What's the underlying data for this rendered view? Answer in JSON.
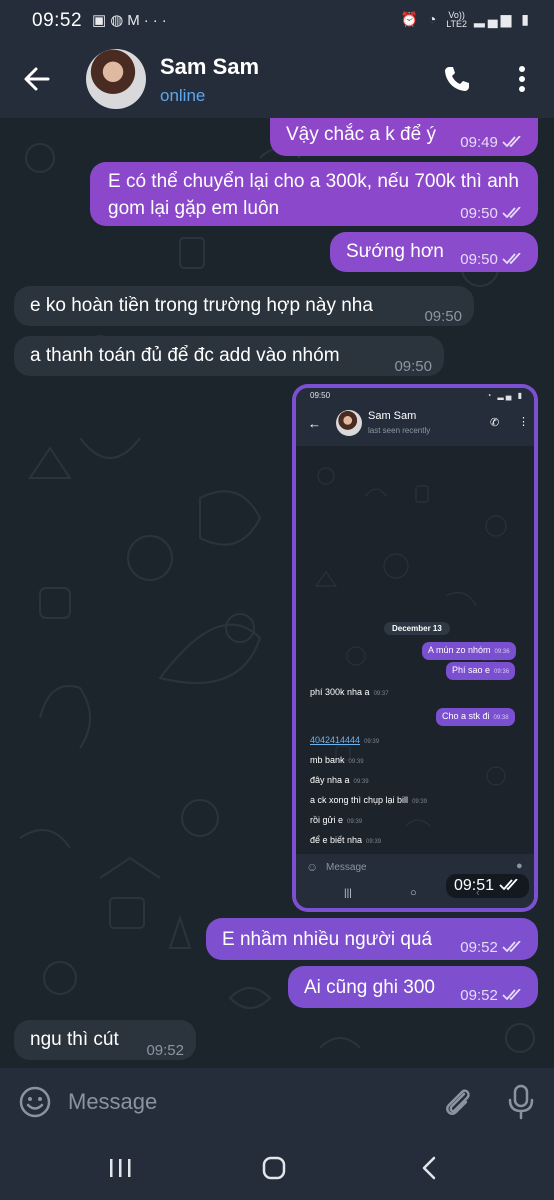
{
  "status_bar": {
    "time": "09:52",
    "left_icons": [
      "gallery-icon",
      "globe-icon",
      "gmail-icon",
      "more-dots-icon"
    ],
    "network_label_top": "Vo))",
    "network_label_bottom": "LTE2"
  },
  "header": {
    "name": "Sam Sam",
    "status": "online"
  },
  "messages": [
    {
      "text": "Vậy chắc a k để ý",
      "time": "09:49",
      "direction": "out"
    },
    {
      "text": "E có thể chuyển lại cho a 300k, nếu 700k thì anh gom lại gặp em luôn",
      "time": "09:50",
      "direction": "out"
    },
    {
      "text": "Sướng hơn",
      "time": "09:50",
      "direction": "out"
    },
    {
      "text": "e ko hoàn tiền trong trường hợp này nha",
      "time": "09:50",
      "direction": "in"
    },
    {
      "text": "a thanh toán đủ để đc add vào nhóm",
      "time": "09:50",
      "direction": "in"
    },
    {
      "text": "E nhầm nhiều người quá",
      "time": "09:52",
      "direction": "out"
    },
    {
      "text": "Ai cũng ghi 300",
      "time": "09:52",
      "direction": "out"
    },
    {
      "text": "ngu thì cút",
      "time": "09:52",
      "direction": "in"
    }
  ],
  "screenshot_message": {
    "time": "09:51",
    "inner": {
      "status_time": "09:50",
      "name": "Sam Sam",
      "last_seen": "last seen recently",
      "date_chip": "December 13",
      "messages": [
        {
          "text": "A mún zo nhóm",
          "time": "09:36",
          "direction": "out"
        },
        {
          "text": "Phí sao e",
          "time": "09:36",
          "direction": "out"
        },
        {
          "text": "phí 300k nha a",
          "time": "09:37",
          "direction": "in"
        },
        {
          "text": "Cho a stk đi",
          "time": "09:38",
          "direction": "out"
        },
        {
          "text": "4042414444",
          "time": "09:39",
          "direction": "in"
        },
        {
          "text": "mb bank",
          "time": "09:39",
          "direction": "in"
        },
        {
          "text": "đây nha a",
          "time": "09:39",
          "direction": "in"
        },
        {
          "text": "a ck xong thì chụp lại bill",
          "time": "09:39",
          "direction": "in"
        },
        {
          "text": "rồi gửi e",
          "time": "09:39",
          "direction": "in"
        },
        {
          "text": "để e biết nha",
          "time": "09:39",
          "direction": "in"
        }
      ],
      "input_placeholder": "Message"
    }
  },
  "input": {
    "placeholder": "Message"
  },
  "colors": {
    "outgoing_bubble": "#7e4fcf",
    "incoming_bubble": "#2b333d",
    "chat_background": "#1d252c",
    "bar_background": "#252d3a",
    "status_online": "#5ea7ee"
  }
}
